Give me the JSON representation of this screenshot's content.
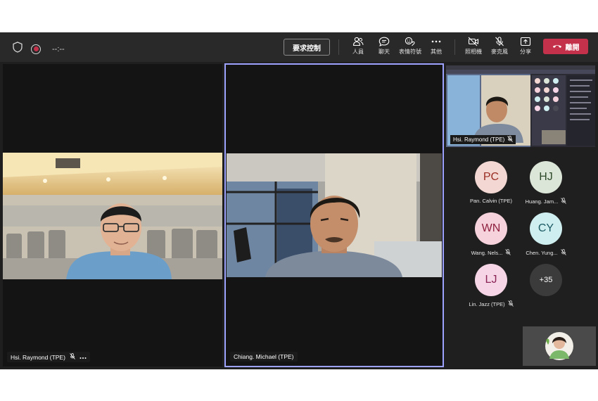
{
  "topbar": {
    "timer": "--:--",
    "request_control": "要求控制",
    "items": [
      {
        "label": "人員",
        "icon": "people-icon"
      },
      {
        "label": "聊天",
        "icon": "chat-icon"
      },
      {
        "label": "表情符號",
        "icon": "reactions-icon"
      },
      {
        "label": "其他",
        "icon": "more-icon"
      },
      {
        "label": "照相機",
        "icon": "camera-off-icon"
      },
      {
        "label": "麥克風",
        "icon": "mic-off-icon"
      },
      {
        "label": "分享",
        "icon": "share-icon"
      }
    ],
    "leave": "離開",
    "colors": {
      "leave": "#c4314b",
      "active_border": "#9ea2ff"
    }
  },
  "tiles": {
    "left": {
      "name": "Hsi. Raymond (TPE)"
    },
    "center": {
      "name": "Chiang. Michael (TPE)"
    },
    "screen_share": {
      "name": "Hsi. Raymond (TPE)"
    }
  },
  "participants": [
    {
      "initials": "PC",
      "name": "Pan. Calvin (TPE)",
      "muted": false,
      "bg": "#f3d7d2",
      "fg": "#9a2d24"
    },
    {
      "initials": "HJ",
      "name": "Huang. Jam...",
      "muted": true,
      "bg": "#dbe6d8",
      "fg": "#2f4a2a"
    },
    {
      "initials": "WN",
      "name": "Wang. Nels...",
      "muted": true,
      "bg": "#f6d3dc",
      "fg": "#8e1f3f"
    },
    {
      "initials": "CY",
      "name": "Chen. Yung...",
      "muted": true,
      "bg": "#cfeef0",
      "fg": "#1b5a63"
    },
    {
      "initials": "LJ",
      "name": "Lin. Jazz (TPE)",
      "muted": true,
      "bg": "#f6d6e6",
      "fg": "#8a2456"
    }
  ],
  "overflow": "+35"
}
